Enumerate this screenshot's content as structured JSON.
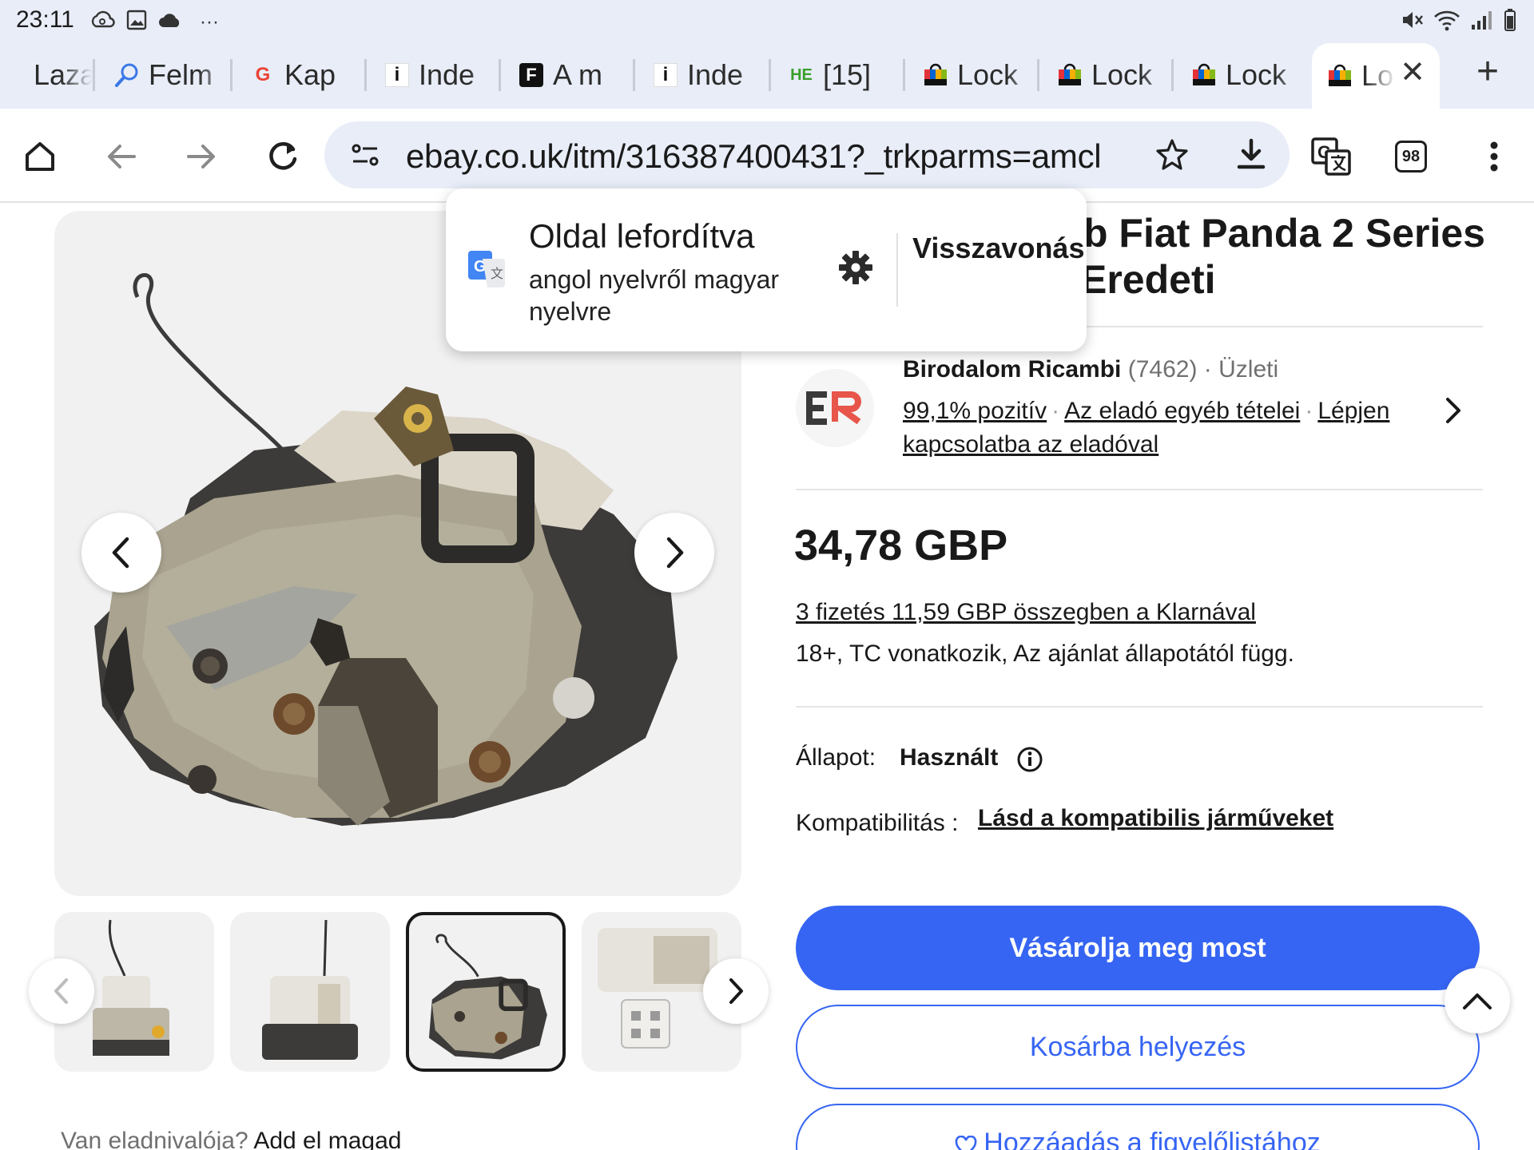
{
  "status_bar": {
    "time": "23:11",
    "more": "···"
  },
  "tabs": [
    {
      "label": "Laza",
      "favicon": "none"
    },
    {
      "label": "Felm",
      "favicon": "search-icon"
    },
    {
      "label": "Kap",
      "favicon": "google-icon",
      "favicon_text": "G"
    },
    {
      "label": "Inde",
      "favicon": "info-icon",
      "favicon_text": "i"
    },
    {
      "label": "A m",
      "favicon": "f-icon",
      "favicon_text": "F"
    },
    {
      "label": "Inde",
      "favicon": "info-icon",
      "favicon_text": "i"
    },
    {
      "label": "[15]",
      "favicon": "he-icon",
      "favicon_text": "HE"
    },
    {
      "label": "Lock",
      "favicon": "ebay-bag-icon"
    },
    {
      "label": "Lock",
      "favicon": "ebay-bag-icon"
    },
    {
      "label": "Lock",
      "favicon": "ebay-bag-icon"
    },
    {
      "label": "Lo",
      "favicon": "ebay-bag-icon",
      "active": true
    }
  ],
  "toolbar": {
    "url": "ebay.co.uk/itm/316387400431?_trkparms=amcl",
    "tab_count": "98"
  },
  "translate_popup": {
    "title": "Oldal lefordítva",
    "subtitle": "angol nyelvről magyar nyelvre",
    "undo_label": "Visszavonás"
  },
  "listing": {
    "title_fragment_1": "b Fiat Panda 2 Series",
    "title_fragment_2": "Eredeti",
    "seller": {
      "name": "Birodalom Ricambi",
      "feedback_count": "(7462)",
      "type": "Üzleti",
      "positive": "99,1% pozitív",
      "other_items": "Az eladó egyéb tételei",
      "contact": "Lépjen kapcsolatba az eladóval"
    },
    "price": "34,78 GBP",
    "klarna": "3 fizetés 11,59 GBP összegben a Klarnával",
    "terms": "18+, TC vonatkozik, Az ajánlat állapotától függ.",
    "condition_label": "Állapot:",
    "condition_value": "Használt",
    "compat_label": "Kompatibilitás :",
    "compat_link": "Lásd a kompatibilis járműveket",
    "buy_now": "Vásárolja meg most",
    "add_to_cart": "Kosárba helyezés",
    "watchlist": "Hozzáadás a figyelőlistához",
    "sell_question": "Van eladnivalója?",
    "sell_link": "Add el magad"
  },
  "colors": {
    "ebay_blue": "#3665f3",
    "chrome_bg": "#e8edf8",
    "text": "#191919"
  }
}
